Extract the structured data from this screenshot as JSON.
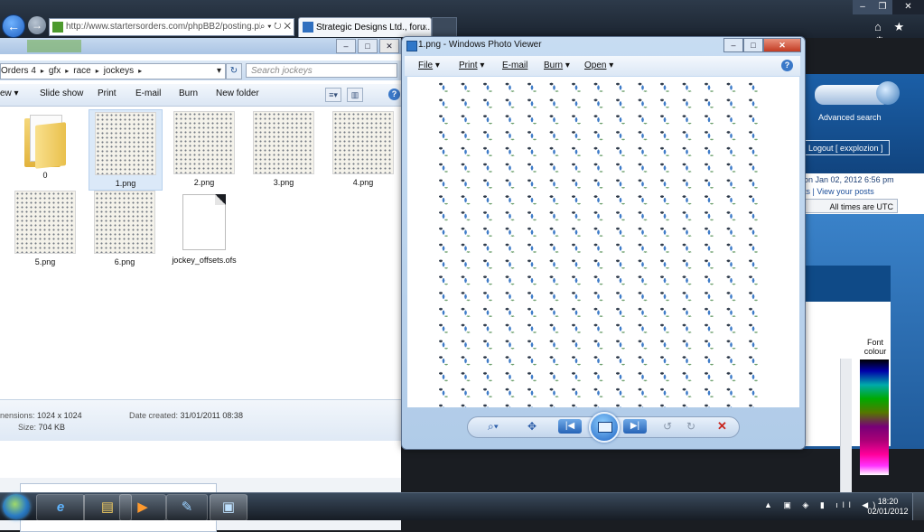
{
  "browser": {
    "address": "http://www.startersorders.com/phpBB2/posting.ph",
    "tab_active": "Strategic Designs Ltd., foru...",
    "tab_close": "×",
    "back_arrow": "←",
    "forward_arrow": "→",
    "address_tools": "⌕ ▾ ↻ ✕",
    "right_icons": "⌂ ★ ⚙",
    "win_min": "–",
    "win_max": "❐",
    "win_close": "✕"
  },
  "explorer": {
    "ctrl_min": "–",
    "ctrl_max": "□",
    "ctrl_close": "✕",
    "breadcrumb": [
      "Orders 4",
      "gfx",
      "race",
      "jockeys"
    ],
    "breadcrumb_dropdown": "▾",
    "refresh_glyph": "↻",
    "search_placeholder": "Search jockeys",
    "toolbar": {
      "view": "ew ▾",
      "slideshow": "Slide show",
      "print": "Print",
      "email": "E-mail",
      "burn": "Burn",
      "new_folder": "New folder"
    },
    "view_btn_1": "≡▾",
    "view_btn_2": "▥",
    "help": "?",
    "files": [
      {
        "name": "0",
        "kind": "folder"
      },
      {
        "name": "1.png",
        "kind": "image",
        "selected": true
      },
      {
        "name": "2.png",
        "kind": "image"
      },
      {
        "name": "3.png",
        "kind": "image"
      },
      {
        "name": "4.png",
        "kind": "image"
      },
      {
        "name": "5.png",
        "kind": "image"
      },
      {
        "name": "6.png",
        "kind": "image"
      },
      {
        "name": "jockey_offsets.ofs",
        "kind": "document"
      }
    ],
    "details": {
      "dimensions_label": "nensions:",
      "dimensions_value": "1024 x 1024",
      "size_label": "Size:",
      "size_value": "704 KB",
      "date_label": "Date created:",
      "date_value": "31/01/2011 08:38"
    }
  },
  "viewer": {
    "title": "1.png - Windows Photo Viewer",
    "ctrl_min": "–",
    "ctrl_max": "□",
    "ctrl_close": "✕",
    "menu": [
      {
        "label": "File",
        "arrow": "▾"
      },
      {
        "label": "Print",
        "arrow": "▾"
      },
      {
        "label": "E-mail",
        "arrow": ""
      },
      {
        "label": "Burn",
        "arrow": "▾"
      },
      {
        "label": "Open",
        "arrow": "▾"
      }
    ],
    "help": "?",
    "controls": {
      "zoom": "⌕▾",
      "actual_size": "✥",
      "previous": "|◀",
      "next": "▶|",
      "rotate_ccw": "↺",
      "rotate_cw": "↻",
      "delete": "✕"
    }
  },
  "forum_page": {
    "advanced_search": "Advanced search",
    "logout": "Logout [ exxplozion ]",
    "last_visit": "on Jan 02, 2012 6:56 pm",
    "view_posts": "ts | View your posts",
    "timezone": "All times are UTC",
    "font_colour": "Font colour"
  },
  "taskbar": {
    "apps": [
      {
        "name": "ie",
        "glyph": "e"
      },
      {
        "name": "explorer",
        "glyph": "▤"
      },
      {
        "name": "media",
        "glyph": "▶"
      },
      {
        "name": "tool",
        "glyph": "✎"
      },
      {
        "name": "photo-viewer",
        "glyph": "▣"
      }
    ],
    "tray": "▲ ▣ ◈ ▮ ıll ◀)",
    "time": "18:20",
    "date": "02/01/2012"
  }
}
